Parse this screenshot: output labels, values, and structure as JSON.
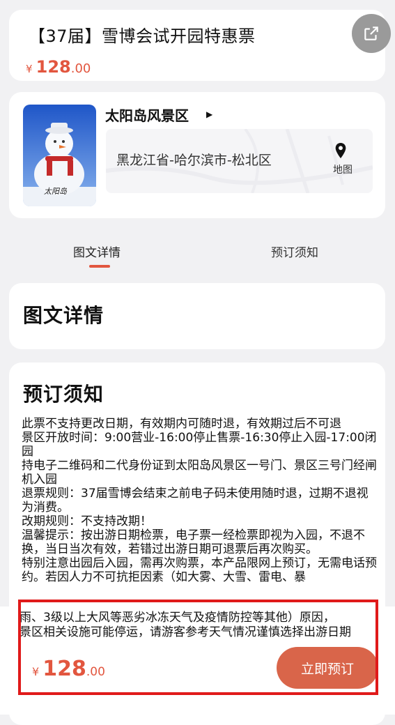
{
  "ticket": {
    "title": "【37届】雪博会试开园特惠票",
    "price_symbol": "¥",
    "price_int": "128",
    "price_dec": ".00"
  },
  "scenic": {
    "name": "太阳岛风景区",
    "address": "黑龙江省-哈尔滨市-松北区",
    "map_label": "地图",
    "thumb_caption": "太阳岛"
  },
  "tabs": {
    "details": "图文详情",
    "notice": "预订须知"
  },
  "details": {
    "heading": "图文详情"
  },
  "notice": {
    "heading": "预订须知",
    "lines": [
      "此票不支持更改日期，有效期内可随时退，有效期过后不可退",
      "景区开放时间：9:00营业-16:00停止售票-16:30停止入园-17:00闭园",
      "持电子二维码和二代身份证到太阳岛风景区一号门、景区三号门经闸机入园",
      "退票规则：37届雪博会结束之前电子码未使用随时退，过期不退视为消费。",
      "改期规则：不支持改期！",
      "温馨提示：按出游日期检票，电子票一经检票即视为入园，不退不换，当日当次有效，若错过出游日期可退票后再次购买。",
      "特别注意出园后入园，需再次购票，本产品限网上预订，无需电话预约。若因人力不可抗拒因素（如大雾、大雪、雷电、暴"
    ],
    "overflow_lines": [
      "雨、3级以上大风等恶劣冰冻天气及疫情防控等其他）原因，",
      "景区相关设施可能停运，请游客参考天气情况谨慎选择出游日期"
    ]
  },
  "bottom_bar": {
    "price_symbol": "¥",
    "price_int": "128",
    "price_dec": ".00",
    "book_button": "立即预订"
  },
  "colors": {
    "accent": "#e2563f",
    "button": "#d9654a",
    "highlight": "#e01a1a"
  }
}
